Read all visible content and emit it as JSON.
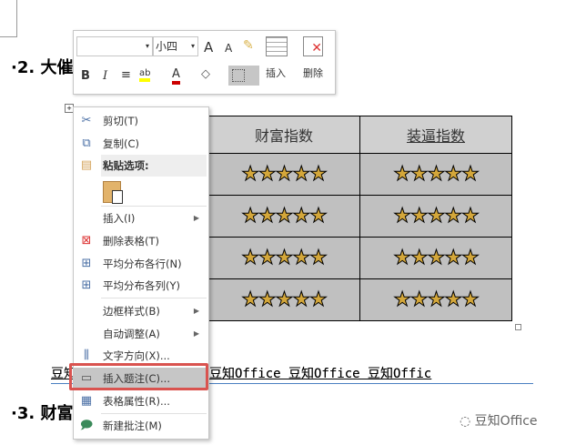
{
  "doc": {
    "heading2": "·2. 大催",
    "heading3": "·3. 财富",
    "caption_line": "豆知Office 豆知Office 豆知Office 豆知Office 豆知Offic",
    "caption_start": "豆",
    "caption_visible": "ce 豆知Office 豆知Office 豆知Office 豆知Offic",
    "watermark": "豆知Office"
  },
  "toolbar": {
    "font_name": "",
    "font_size": "小四",
    "grow_font": "A",
    "shrink_font": "A",
    "bold": "B",
    "italic": "I",
    "font_color": "A",
    "insert_label": "插入",
    "delete_label": "删除"
  },
  "table": {
    "headers": [
      "财富指数",
      "装逼指数"
    ],
    "rows": [
      [
        "★★★★★",
        "★★★★★"
      ],
      [
        "★★★★★",
        "★★★★★"
      ],
      [
        "★★★★★",
        "★★★★★"
      ],
      [
        "★★★★★",
        "★★★★★"
      ]
    ]
  },
  "menu": {
    "items": [
      {
        "label": "剪切(T)",
        "icon": "scissors-icon"
      },
      {
        "label": "复制(C)",
        "icon": "copy-icon"
      },
      {
        "label": "粘贴选项:",
        "icon": "paste-icon"
      },
      {
        "label": "插入(I)",
        "icon": ""
      },
      {
        "label": "删除表格(T)",
        "icon": "delete-table-icon"
      },
      {
        "label": "平均分布各行(N)",
        "icon": "distribute-rows-icon"
      },
      {
        "label": "平均分布各列(Y)",
        "icon": "distribute-columns-icon"
      },
      {
        "label": "边框样式(B)",
        "icon": ""
      },
      {
        "label": "自动调整(A)",
        "icon": ""
      },
      {
        "label": "文字方向(X)...",
        "icon": "text-direction-icon"
      },
      {
        "label": "插入题注(C)...",
        "icon": "caption-icon"
      },
      {
        "label": "表格属性(R)...",
        "icon": "table-properties-icon"
      },
      {
        "label": "新建批注(M)",
        "icon": "comment-icon"
      }
    ]
  },
  "colors": {
    "highlight_border": "#d9534f",
    "menu_highlight": "#c6c6c6"
  }
}
